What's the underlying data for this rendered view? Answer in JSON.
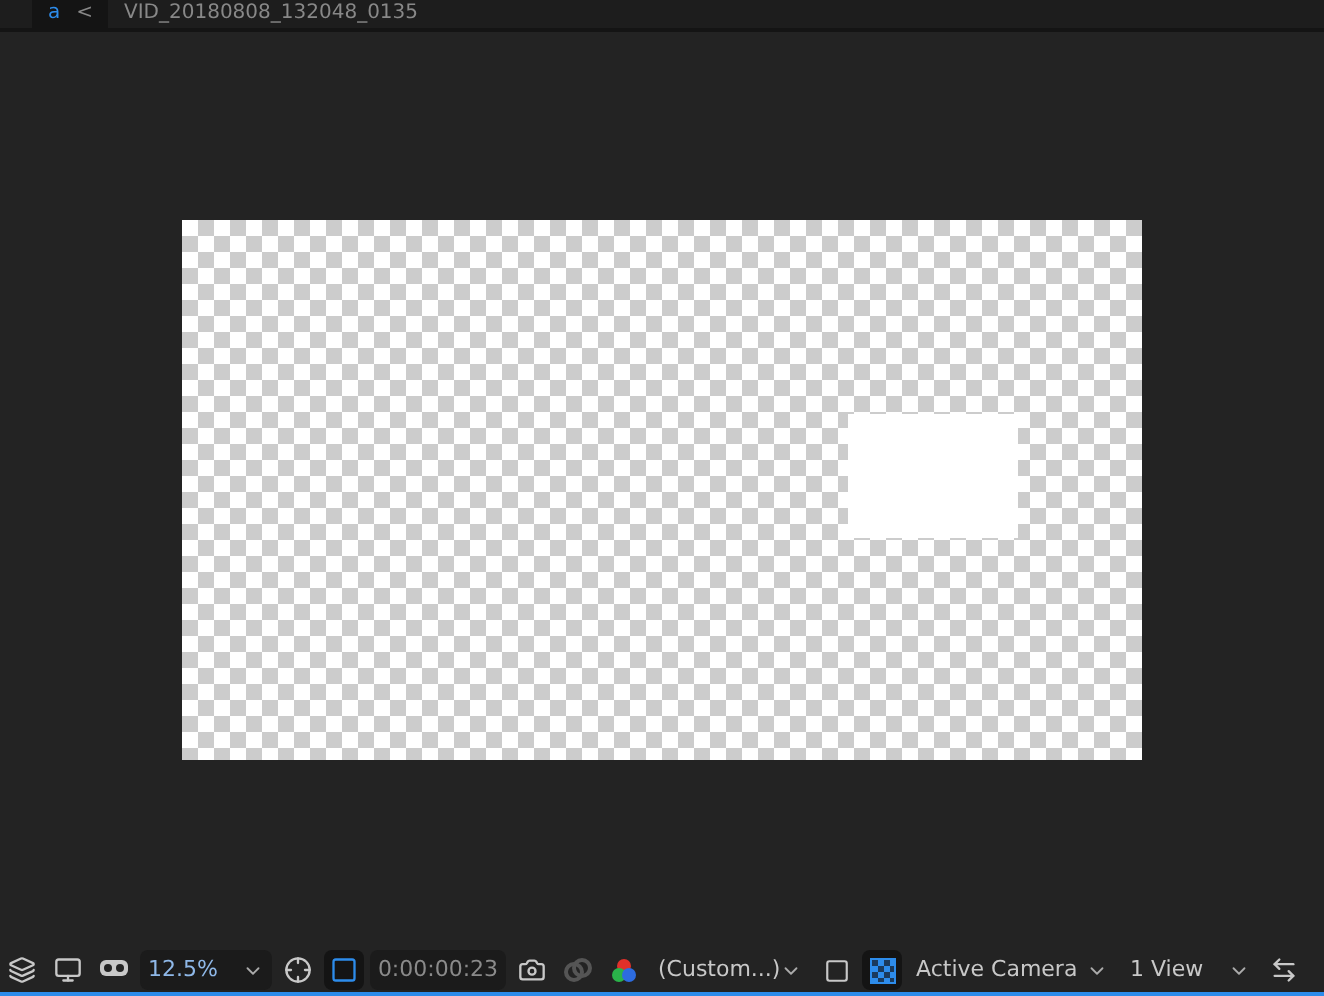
{
  "tab": {
    "label": "a",
    "close": "<"
  },
  "composition": {
    "title": "VID_20180808_132048_0135"
  },
  "toolbar": {
    "zoom": "12.5%",
    "timecode": "0:00:00:23",
    "channel": "(Custom...)",
    "camera": "Active Camera",
    "views": "1 View",
    "mask_on": true,
    "grid_on": true
  }
}
